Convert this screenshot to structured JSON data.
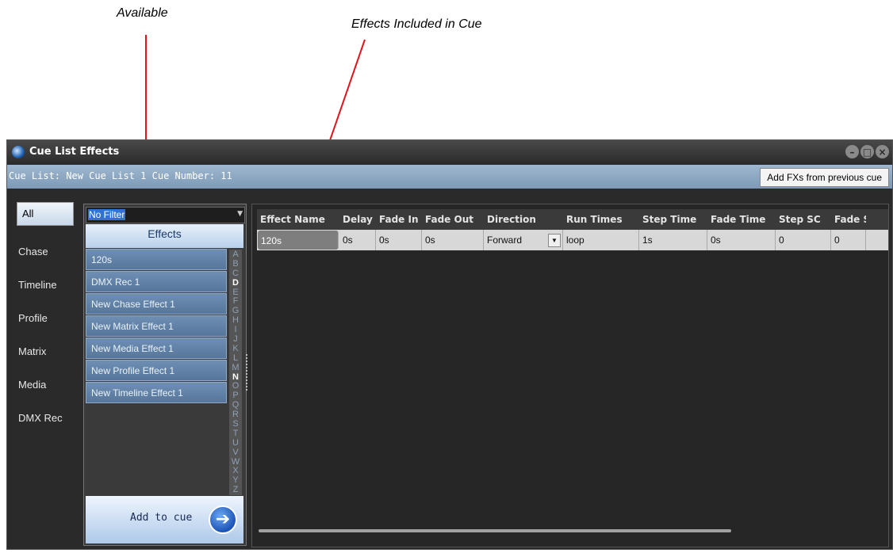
{
  "annotations": {
    "available": "Available",
    "included": "Effects Included in Cue",
    "line_color": "#e0141c"
  },
  "window": {
    "title": "Cue List Effects",
    "controls": [
      "minimize-icon",
      "maximize-icon",
      "close-icon"
    ]
  },
  "infobar": {
    "cue_text": "Cue List: New Cue List 1 Cue Number: 11",
    "add_prev_label": "Add FXs from previous cue"
  },
  "categories": [
    "All",
    "Chase",
    "Timeline",
    "Profile",
    "Matrix",
    "Media",
    "DMX Rec"
  ],
  "filter": {
    "value": "No Filter"
  },
  "effects_header": "Effects",
  "effects": [
    "120s",
    "DMX Rec 1",
    "New Chase Effect 1",
    "New Matrix Effect 1",
    "New Media Effect 1",
    "New Profile Effect 1",
    "New Timeline Effect 1"
  ],
  "alphabet": [
    "A",
    "B",
    "C",
    "D",
    "E",
    "F",
    "G",
    "H",
    "I",
    "J",
    "K",
    "L",
    "M",
    "N",
    "O",
    "P",
    "Q",
    "R",
    "S",
    "T",
    "U",
    "V",
    "W",
    "X",
    "Y",
    "Z"
  ],
  "alphabet_active": [
    "D",
    "N"
  ],
  "add_to_cue_label": "Add to cue",
  "grid": {
    "columns": [
      "Effect Name",
      "Delay",
      "Fade In",
      "Fade Out",
      "Direction",
      "Run Times",
      "Step Time",
      "Fade Time",
      "Step SC",
      "Fade S"
    ],
    "rows": [
      [
        "120s",
        "0s",
        "0s",
        "0s",
        "Forward",
        "loop",
        "1s",
        "0s",
        "0",
        "0"
      ]
    ]
  }
}
